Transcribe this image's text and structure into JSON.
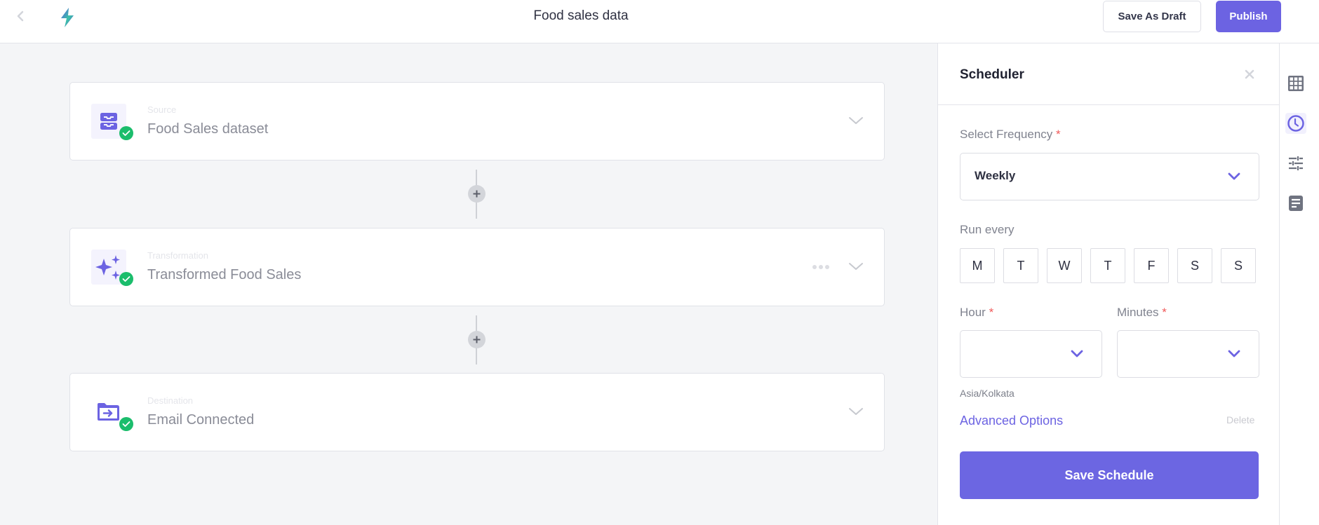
{
  "header": {
    "title": "Food sales data",
    "back_icon": "chevron-left-icon",
    "logo_icon": "lightning-bolt-logo",
    "save_draft_label": "Save As Draft",
    "publish_label": "Publish"
  },
  "pipeline": {
    "steps": [
      {
        "type_label": "Source",
        "title": "Food Sales dataset",
        "icon": "inbox-tray-icon",
        "status": "connected",
        "has_more_menu": false
      },
      {
        "type_label": "Transformation",
        "title": "Transformed Food Sales",
        "icon": "sparkles-icon",
        "status": "connected",
        "has_more_menu": true
      },
      {
        "type_label": "Destination",
        "title": "Email Connected",
        "icon": "folder-arrow-icon",
        "status": "connected",
        "has_more_menu": false
      }
    ]
  },
  "scheduler": {
    "title": "Scheduler",
    "frequency_label": "Select Frequency",
    "frequency_value": "Weekly",
    "run_every_label": "Run every",
    "days": [
      "M",
      "T",
      "W",
      "T",
      "F",
      "S",
      "S"
    ],
    "hour_label": "Hour",
    "hour_value": "",
    "minutes_label": "Minutes",
    "minutes_value": "",
    "required_marker": "*",
    "timezone": "Asia/Kolkata",
    "advanced_options_label": "Advanced Options",
    "delete_label": "Delete",
    "save_label": "Save Schedule"
  },
  "rail": {
    "items": [
      {
        "icon": "table-grid-icon",
        "active": false
      },
      {
        "icon": "clock-icon",
        "active": true
      },
      {
        "icon": "sliders-icon",
        "active": false
      },
      {
        "icon": "document-icon",
        "active": false
      }
    ]
  },
  "colors": {
    "accent": "#6c63e2",
    "success": "#1bbd6c",
    "required": "#f05a5a"
  }
}
